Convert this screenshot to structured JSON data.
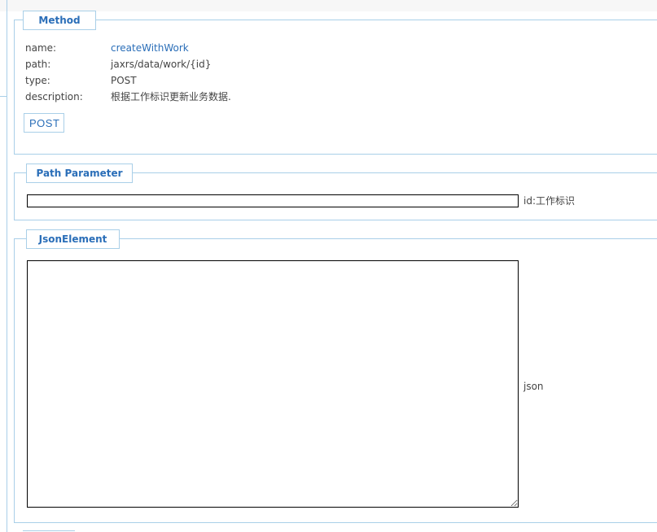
{
  "method": {
    "legend": "Method",
    "fields": [
      {
        "key": "name:",
        "value": "createWithWork"
      },
      {
        "key": "path:",
        "value": "jaxrs/data/work/{id}"
      },
      {
        "key": "type:",
        "value": "POST"
      },
      {
        "key": "description:",
        "value": "根据工作标识更新业务数据."
      }
    ],
    "button_label": "POST"
  },
  "path_parameter": {
    "legend": "Path Parameter",
    "input_value": "",
    "label": "id:工作标识"
  },
  "json_element": {
    "legend": "JsonElement",
    "textarea_value": "",
    "label": "json"
  }
}
